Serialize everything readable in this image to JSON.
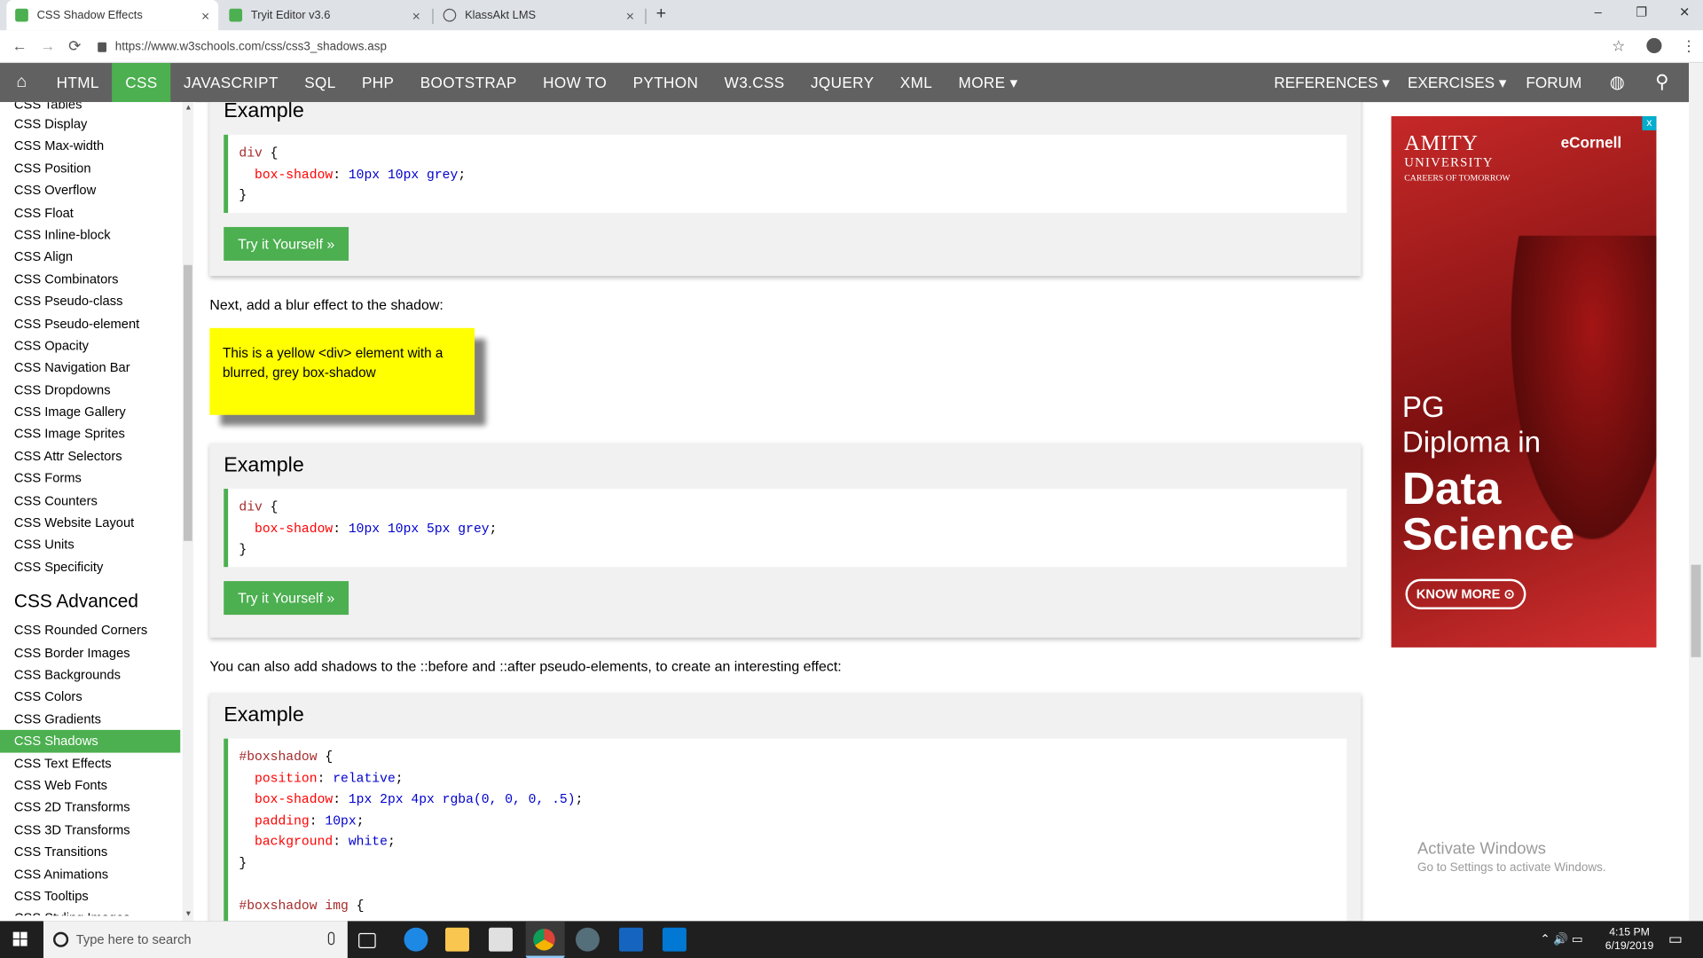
{
  "browser": {
    "tabs": [
      {
        "title": "CSS Shadow Effects",
        "close": "×"
      },
      {
        "title": "Tryit Editor v3.6",
        "close": "×"
      },
      {
        "title": "KlassAkt LMS",
        "close": "×"
      }
    ],
    "new_tab": "+",
    "window_controls": {
      "minimize": "–",
      "maximize": "❐",
      "close": "✕"
    },
    "nav": {
      "back": "←",
      "forward": "→",
      "reload": "⟳"
    },
    "url": "https://www.w3schools.com/css/css3_shadows.asp",
    "star": "☆",
    "menu": "⋮"
  },
  "topnav": {
    "home": "⌂",
    "items": [
      "HTML",
      "CSS",
      "JAVASCRIPT",
      "SQL",
      "PHP",
      "BOOTSTRAP",
      "HOW TO",
      "PYTHON",
      "W3.CSS",
      "JQUERY",
      "XML",
      "MORE ▾"
    ],
    "right": [
      "REFERENCES ▾",
      "EXERCISES ▾",
      "FORUM"
    ],
    "globe": "◍",
    "search": "⚲"
  },
  "sidebar": {
    "partial_top": "CSS Tables",
    "links_basic": [
      "CSS Display",
      "CSS Max-width",
      "CSS Position",
      "CSS Overflow",
      "CSS Float",
      "CSS Inline-block",
      "CSS Align",
      "CSS Combinators",
      "CSS Pseudo-class",
      "CSS Pseudo-element",
      "CSS Opacity",
      "CSS Navigation Bar",
      "CSS Dropdowns",
      "CSS Image Gallery",
      "CSS Image Sprites",
      "CSS Attr Selectors",
      "CSS Forms",
      "CSS Counters",
      "CSS Website Layout",
      "CSS Units",
      "CSS Specificity"
    ],
    "advanced_heading": "CSS Advanced",
    "links_advanced": [
      "CSS Rounded Corners",
      "CSS Border Images",
      "CSS Backgrounds",
      "CSS Colors",
      "CSS Gradients",
      "CSS Shadows",
      "CSS Text Effects",
      "CSS Web Fonts",
      "CSS 2D Transforms",
      "CSS 3D Transforms",
      "CSS Transitions",
      "CSS Animations",
      "CSS Tooltips"
    ],
    "partial_bottom": "CSS Styling Images"
  },
  "main": {
    "example_heading": "Example",
    "try_button": "Try it Yourself »",
    "ex1_code": {
      "sel": "div",
      "prop": "box-shadow",
      "val": "10px 10px grey"
    },
    "para1": "Next, add a blur effect to the shadow:",
    "yellow_text": "This is a yellow <div> element with a blurred, grey box-shadow",
    "ex2_code": {
      "sel": "div",
      "prop": "box-shadow",
      "val": "10px 10px 5px grey"
    },
    "para2": "You can also add shadows to the ::before and ::after pseudo-elements, to create an interesting effect:",
    "ex3_code": {
      "sel": "#boxshadow",
      "lines": [
        {
          "prop": "position",
          "val": "relative"
        },
        {
          "prop": "box-shadow",
          "val": "1px 2px 4px rgba(0, 0, 0, .5)"
        },
        {
          "prop": "padding",
          "val": "10px"
        },
        {
          "prop": "background",
          "val": "white"
        }
      ],
      "next_sel": "#boxshadow img"
    }
  },
  "ad": {
    "amity1": "AMITY",
    "amity2": "UNIVERSITY",
    "amity3": "CAREERS OF TOMORROW",
    "ecornell": "eCornell",
    "pg": "PG",
    "diploma": "Diploma in",
    "data": "Data",
    "science": "Science",
    "cta": "KNOW MORE ⊙",
    "close": "x"
  },
  "watermark": {
    "line1": "Activate Windows",
    "line2": "Go to Settings to activate Windows."
  },
  "taskbar": {
    "search_placeholder": "Type here to search",
    "time": "4:15 PM",
    "date": "6/19/2019",
    "tray_icons": "⌃ 🔊 ▭"
  },
  "colors": {
    "accent": "#4caf50",
    "nav": "#616161",
    "yellow": "#ffff00"
  }
}
